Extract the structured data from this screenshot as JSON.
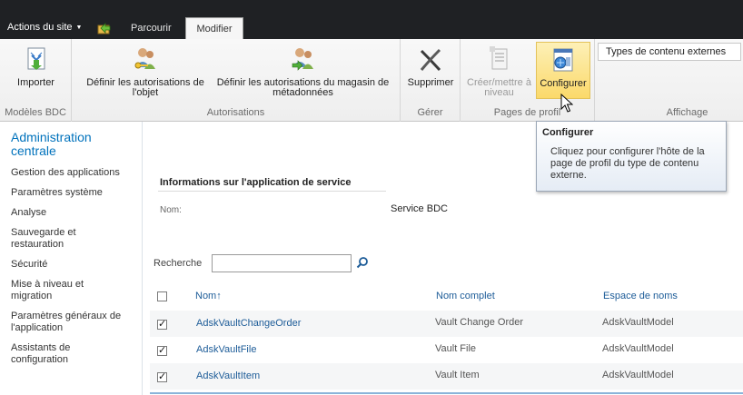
{
  "topbar": {
    "site_actions": "Actions du site",
    "tabs": [
      {
        "label": "Parcourir"
      },
      {
        "label": "Modifier"
      }
    ]
  },
  "ribbon": {
    "groups": [
      {
        "label": "Modèles BDC",
        "buttons": [
          {
            "label": "Importer"
          }
        ]
      },
      {
        "label": "Autorisations",
        "buttons": [
          {
            "label": "Définir les autorisations de l'objet"
          },
          {
            "label": "Définir les autorisations du magasin de métadonnées"
          }
        ]
      },
      {
        "label": "Gérer",
        "buttons": [
          {
            "label": "Supprimer"
          }
        ]
      },
      {
        "label": "Pages de profil",
        "buttons": [
          {
            "label": "Créer/mettre à niveau"
          },
          {
            "label": "Configurer"
          }
        ]
      },
      {
        "label": "Affichage"
      }
    ],
    "view_select": "Types de contenu externes"
  },
  "tooltip": {
    "title": "Configurer",
    "body": "Cliquez pour configurer l'hôte de la page de profil du type de contenu externe."
  },
  "leftnav": {
    "title": "Administration centrale",
    "items": [
      "Gestion des applications",
      "Paramètres système",
      "Analyse",
      "Sauvegarde et restauration",
      "Sécurité",
      "Mise à niveau et migration",
      "Paramètres généraux de l'application",
      "Assistants de configuration"
    ]
  },
  "main": {
    "section_title": "Informations sur l'application de service",
    "name_label": "Nom:",
    "name_value": "Service BDC",
    "search_label": "Recherche",
    "search_value": "",
    "columns": [
      "Nom↑",
      "Nom complet",
      "Espace de noms"
    ],
    "rows": [
      {
        "name": "AdskVaultChangeOrder",
        "full": "Vault Change Order",
        "ns": "AdskVaultModel",
        "checked": true
      },
      {
        "name": "AdskVaultFile",
        "full": "Vault File",
        "ns": "AdskVaultModel",
        "checked": true
      },
      {
        "name": "AdskVaultItem",
        "full": "Vault Item",
        "ns": "AdskVaultModel",
        "checked": true
      }
    ]
  }
}
